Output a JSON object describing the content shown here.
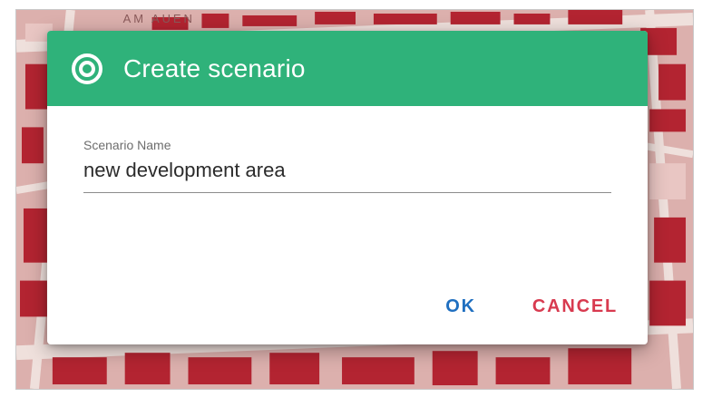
{
  "dialog": {
    "title": "Create scenario",
    "icon": "target-icon",
    "header_color": "#2fb27a",
    "field": {
      "label": "Scenario Name",
      "value": "new development area"
    },
    "buttons": {
      "ok_label": "OK",
      "cancel_label": "CANCEL"
    }
  },
  "map": {
    "street_label": "AM AUEN"
  },
  "colors": {
    "ok": "#1f6fc0",
    "cancel": "#d83a4f"
  }
}
